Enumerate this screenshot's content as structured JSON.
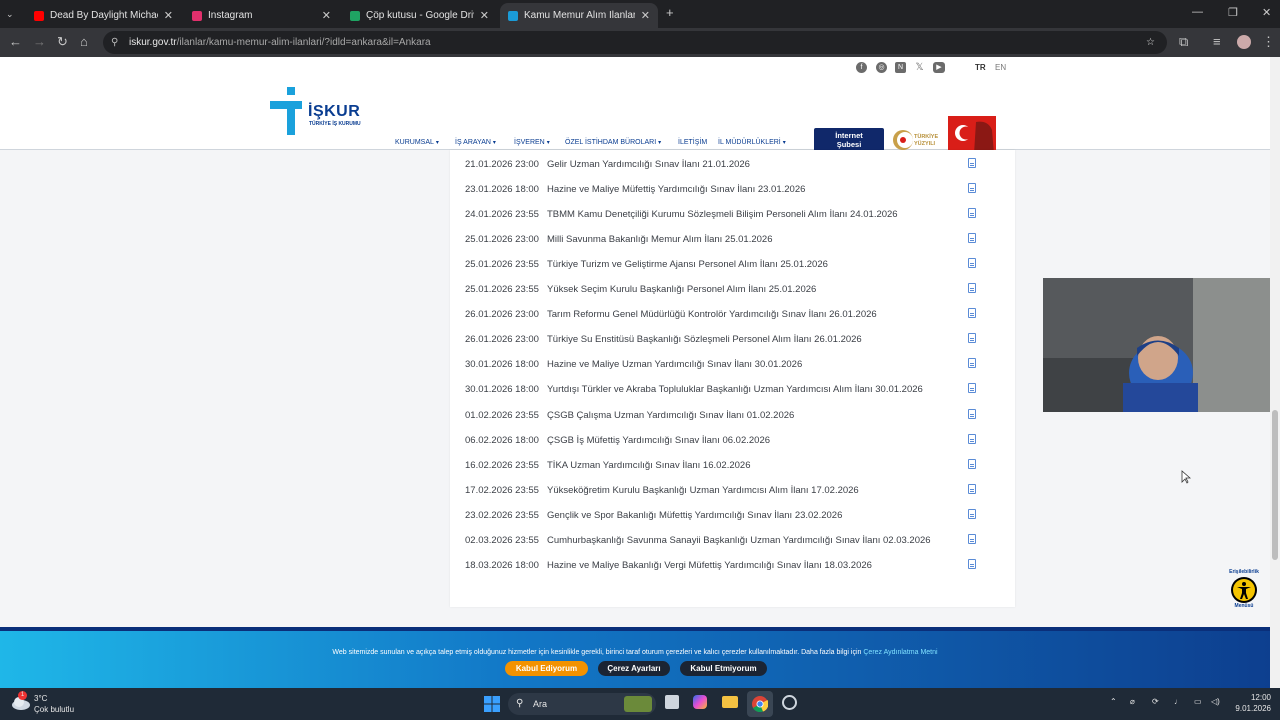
{
  "browser": {
    "tabs": [
      {
        "title": "Dead By Daylight Michael Myers",
        "icon": "youtube-icon",
        "color": "#ff0000"
      },
      {
        "title": "Instagram",
        "icon": "instagram-icon",
        "color": "#e1306c"
      },
      {
        "title": "Çöp kutusu - Google Drive",
        "icon": "google-drive-icon",
        "color": "#1fa463"
      },
      {
        "title": "Kamu Memur Alım İlanları - Türk",
        "icon": "iskur-icon",
        "color": "#1a9bd7"
      }
    ],
    "url_host": "iskur.gov.tr",
    "url_path": "/ilanlar/kamu-memur-alim-ilanlari/?idld=ankara&il=Ankara"
  },
  "site": {
    "lang_tr": "TR",
    "lang_en": "EN",
    "logo_title": "İŞKUR",
    "logo_subtitle": "TÜRKİYE İŞ KURUMU",
    "menu": [
      "KURUMSAL",
      "İŞ ARAYAN",
      "İŞVEREN",
      "ÖZEL İSTİHDAM BÜROLARI",
      "İLETİŞİM",
      "İL MÜDÜRLÜKLERİ"
    ],
    "internet_branch_line1": "İnternet",
    "internet_branch_line2": "Şubesi",
    "turkiye_yuzyili_line1": "TÜRKİYE",
    "turkiye_yuzyili_line2": "YÜZYILI",
    "accessibility_label_top": "Erişilebilirlik",
    "accessibility_label_bottom": "Menüsü"
  },
  "listings": [
    {
      "date": "21.01.2026 23:00",
      "title": "Gelir Uzman Yardımcılığı Sınav İlanı 21.01.2026"
    },
    {
      "date": "23.01.2026 18:00",
      "title": "Hazine ve Maliye Müfettiş Yardımcılığı Sınav İlanı 23.01.2026"
    },
    {
      "date": "24.01.2026 23:55",
      "title": "TBMM Kamu Denetçiliği Kurumu Sözleşmeli Bilişim Personeli Alım İlanı 24.01.2026"
    },
    {
      "date": "25.01.2026 23:00",
      "title": "Milli Savunma Bakanlığı Memur Alım İlanı 25.01.2026"
    },
    {
      "date": "25.01.2026 23:55",
      "title": "Türkiye Turizm ve Geliştirme Ajansı Personel Alım İlanı 25.01.2026"
    },
    {
      "date": "25.01.2026 23:55",
      "title": "Yüksek Seçim Kurulu Başkanlığı Personel Alım İlanı 25.01.2026"
    },
    {
      "date": "26.01.2026 23:00",
      "title": "Tarım Reformu Genel Müdürlüğü Kontrolör Yardımcılığı Sınav İlanı 26.01.2026"
    },
    {
      "date": "26.01.2026 23:00",
      "title": "Türkiye Su Enstitüsü Başkanlığı Sözleşmeli Personel Alım İlanı 26.01.2026"
    },
    {
      "date": "30.01.2026 18:00",
      "title": "Hazine ve Maliye Uzman Yardımcılığı Sınav İlanı 30.01.2026"
    },
    {
      "date": "30.01.2026 18:00",
      "title": "Yurtdışı Türkler ve Akraba Topluluklar Başkanlığı Uzman Yardımcısı Alım İlanı 30.01.2026"
    },
    {
      "date": "01.02.2026 23:55",
      "title": "ÇSGB Çalışma Uzman Yardımcılığı Sınav İlanı 01.02.2026"
    },
    {
      "date": "06.02.2026 18:00",
      "title": "ÇSGB İş Müfettiş Yardımcılığı Sınav İlanı 06.02.2026"
    },
    {
      "date": "16.02.2026 23:55",
      "title": "TİKA Uzman Yardımcılığı Sınav İlanı 16.02.2026"
    },
    {
      "date": "17.02.2026 23:55",
      "title": "Yükseköğretim Kurulu Başkanlığı Uzman Yardımcısı Alım İlanı 17.02.2026"
    },
    {
      "date": "23.02.2026 23:55",
      "title": "Gençlik ve Spor Bakanlığı Müfettiş Yardımcılığı Sınav İlanı 23.02.2026"
    },
    {
      "date": "02.03.2026 23:55",
      "title": "Cumhurbaşkanlığı Savunma Sanayii Başkanlığı Uzman Yardımcılığı Sınav İlanı 02.03.2026"
    },
    {
      "date": "18.03.2026 18:00",
      "title": "Hazine ve Maliye Bakanlığı Vergi Müfettiş Yardımcılığı Sınav İlanı 18.03.2026"
    }
  ],
  "cookie": {
    "text": "Web sitemizde sunulan ve açıkça talep etmiş olduğunuz hizmetler için kesinlikle gerekli, birinci taraf oturum çerezleri ve kalıcı çerezler kullanılmaktadır. Daha fazla bilgi için",
    "link": "Çerez Aydınlatma Metni",
    "accept": "Kabul Ediyorum",
    "settings": "Çerez Ayarları",
    "reject": "Kabul Etmiyorum",
    "accept_color": "#f39200",
    "dark_btn_color": "#1b2433"
  },
  "taskbar": {
    "temp": "3°C",
    "weather": "Çok bulutlu",
    "weather_badge": "1",
    "search": "Ara",
    "time": "12:00",
    "date": "9.01.2026"
  }
}
